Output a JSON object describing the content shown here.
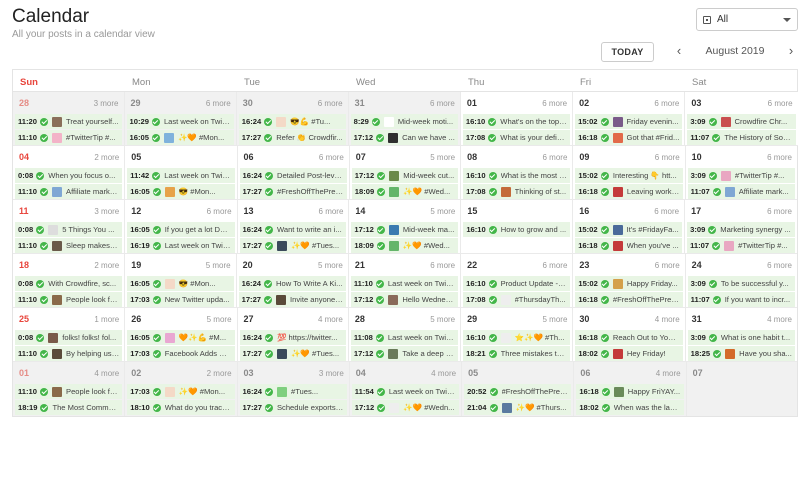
{
  "header": {
    "title": "Calendar",
    "subtitle": "All your posts in a calendar view",
    "filter_label": "All",
    "filter_icon": "facebook-page-icon"
  },
  "toolbar": {
    "today_label": "TODAY",
    "prev_glyph": "‹",
    "next_glyph": "›",
    "month_label": "August 2019"
  },
  "weekdays": [
    "Sun",
    "Mon",
    "Tue",
    "Wed",
    "Thu",
    "Fri",
    "Sat"
  ],
  "colors": {
    "accent_red": "#e8453c",
    "success_green": "#43b649",
    "post_bg": "#e8f5e4"
  },
  "weeks": [
    [
      {
        "num": "28",
        "more": "3 more",
        "other": true,
        "posts": [
          {
            "time": "11:20",
            "text": "Treat yourself...",
            "thumb": "#8a6f5a"
          },
          {
            "time": "11:10",
            "text": "#TwitterTip #...",
            "thumb": "#f3b3c8"
          }
        ]
      },
      {
        "num": "29",
        "more": "6 more",
        "other": true,
        "posts": [
          {
            "time": "10:29",
            "text": "Last week on Twitt...",
            "thumb": ""
          },
          {
            "time": "16:05",
            "text": "✨🧡 #Mon...",
            "thumb": "#7fb2dc"
          }
        ]
      },
      {
        "num": "30",
        "more": "6 more",
        "other": true,
        "posts": [
          {
            "time": "16:24",
            "text": "😎💪 #Tu...",
            "thumb": "#f4d9c7"
          },
          {
            "time": "17:27",
            "text": "Refer 👏 Crowdfir...",
            "thumb": ""
          }
        ]
      },
      {
        "num": "31",
        "more": "6 more",
        "other": true,
        "posts": [
          {
            "time": "8:29",
            "text": "Mid-week moti...",
            "thumb": "#ffffff"
          },
          {
            "time": "17:12",
            "text": "Can we have ...",
            "thumb": "#2f2f2f"
          }
        ]
      },
      {
        "num": "01",
        "more": "6 more",
        "other": false,
        "posts": [
          {
            "time": "16:10",
            "text": "What's on the top ...",
            "thumb": ""
          },
          {
            "time": "17:08",
            "text": "What is your defin...",
            "thumb": ""
          }
        ]
      },
      {
        "num": "02",
        "more": "6 more",
        "other": false,
        "posts": [
          {
            "time": "15:02",
            "text": "Friday evenin...",
            "thumb": "#7a5a8a"
          },
          {
            "time": "16:18",
            "text": "Got that #Frid...",
            "thumb": "#e26a4a"
          }
        ]
      },
      {
        "num": "03",
        "more": "6 more",
        "other": false,
        "posts": [
          {
            "time": "3:09",
            "text": "Crowdfire Chr...",
            "thumb": "#c94f4f"
          },
          {
            "time": "11:07",
            "text": "The History of Soci...",
            "thumb": ""
          }
        ]
      }
    ],
    [
      {
        "num": "04",
        "more": "2 more",
        "other": false,
        "sun": true,
        "posts": [
          {
            "time": "0:08",
            "text": "When you focus o...",
            "thumb": ""
          },
          {
            "time": "11:10",
            "text": "Affiliate marke...",
            "thumb": "#7fa7d4"
          }
        ]
      },
      {
        "num": "05",
        "more": "",
        "other": false,
        "posts": [
          {
            "time": "11:42",
            "text": "Last week on Twitt...",
            "thumb": ""
          },
          {
            "time": "16:05",
            "text": "😎 #Mon...",
            "thumb": "#e7a24a"
          }
        ]
      },
      {
        "num": "06",
        "more": "6 more",
        "other": false,
        "posts": [
          {
            "time": "16:24",
            "text": "Detailed Post-level...",
            "thumb": ""
          },
          {
            "time": "17:27",
            "text": "#FreshOffThePres...",
            "thumb": ""
          }
        ]
      },
      {
        "num": "07",
        "more": "5 more",
        "other": false,
        "posts": [
          {
            "time": "17:12",
            "text": "Mid-week cut...",
            "thumb": "#6a8a4a"
          },
          {
            "time": "18:09",
            "text": "✨🧡 #Wed...",
            "thumb": "#64b56a"
          }
        ]
      },
      {
        "num": "08",
        "more": "6 more",
        "other": false,
        "posts": [
          {
            "time": "16:10",
            "text": "What is the most c...",
            "thumb": ""
          },
          {
            "time": "17:08",
            "text": "Thinking of st...",
            "thumb": "#c46a3a"
          }
        ]
      },
      {
        "num": "09",
        "more": "6 more",
        "other": false,
        "posts": [
          {
            "time": "15:02",
            "text": "Interesting 👇 htt...",
            "thumb": ""
          },
          {
            "time": "16:18",
            "text": "Leaving work ...",
            "thumb": "#c43a3a"
          }
        ]
      },
      {
        "num": "10",
        "more": "6 more",
        "other": false,
        "posts": [
          {
            "time": "3:09",
            "text": "#TwitterTip #...",
            "thumb": "#e9a7c2"
          },
          {
            "time": "11:07",
            "text": "Affiliate mark...",
            "thumb": "#7fa7d4"
          }
        ]
      }
    ],
    [
      {
        "num": "11",
        "more": "3 more",
        "other": false,
        "sun": true,
        "posts": [
          {
            "time": "0:08",
            "text": "5 Things You ...",
            "thumb": "#dddddd"
          },
          {
            "time": "11:10",
            "text": "Sleep makes u...",
            "thumb": "#6a5a4a"
          }
        ]
      },
      {
        "num": "12",
        "more": "6 more",
        "other": false,
        "posts": [
          {
            "time": "16:05",
            "text": "If you get a lot DM...",
            "thumb": ""
          },
          {
            "time": "16:19",
            "text": "Last week on Twitt...",
            "thumb": ""
          }
        ]
      },
      {
        "num": "13",
        "more": "6 more",
        "other": false,
        "posts": [
          {
            "time": "16:24",
            "text": "Want to write an i...",
            "thumb": ""
          },
          {
            "time": "17:27",
            "text": "✨🧡 #Tues...",
            "thumb": "#3a4a5a"
          }
        ]
      },
      {
        "num": "14",
        "more": "5 more",
        "other": false,
        "posts": [
          {
            "time": "17:12",
            "text": "Mid-week ma...",
            "thumb": "#3a7ab0"
          },
          {
            "time": "18:09",
            "text": "✨🧡 #Wed...",
            "thumb": "#64b56a"
          }
        ]
      },
      {
        "num": "15",
        "more": "",
        "other": false,
        "posts": [
          {
            "time": "16:10",
            "text": "How to grow and ...",
            "thumb": ""
          }
        ]
      },
      {
        "num": "16",
        "more": "6 more",
        "other": false,
        "posts": [
          {
            "time": "15:02",
            "text": "It's #FridayFa...",
            "thumb": "#4a6a9a"
          },
          {
            "time": "16:18",
            "text": "When you've ...",
            "thumb": "#c43a3a"
          }
        ]
      },
      {
        "num": "17",
        "more": "6 more",
        "other": false,
        "posts": [
          {
            "time": "3:09",
            "text": "Marketing synergy ...",
            "thumb": ""
          },
          {
            "time": "11:07",
            "text": "#TwitterTip #...",
            "thumb": "#e9a7c2"
          }
        ]
      }
    ],
    [
      {
        "num": "18",
        "more": "2 more",
        "other": false,
        "sun": true,
        "posts": [
          {
            "time": "0:08",
            "text": "With Crowdfire, sc...",
            "thumb": ""
          },
          {
            "time": "11:10",
            "text": "People look fo...",
            "thumb": "#8a6a4a"
          }
        ]
      },
      {
        "num": "19",
        "more": "5 more",
        "other": false,
        "posts": [
          {
            "time": "16:05",
            "text": "😎 #Mon...",
            "thumb": "#f4d9c7"
          },
          {
            "time": "17:03",
            "text": "New Twitter upda...",
            "thumb": ""
          }
        ]
      },
      {
        "num": "20",
        "more": "5 more",
        "other": false,
        "posts": [
          {
            "time": "16:24",
            "text": "How To Write A Ki...",
            "thumb": ""
          },
          {
            "time": "17:27",
            "text": "Invite anyone ...",
            "thumb": "#5a4a3a"
          }
        ]
      },
      {
        "num": "21",
        "more": "6 more",
        "other": false,
        "posts": [
          {
            "time": "11:10",
            "text": "Last week on Twitt...",
            "thumb": ""
          },
          {
            "time": "17:12",
            "text": "Hello Wednes...",
            "thumb": "#8a6a5a"
          }
        ]
      },
      {
        "num": "22",
        "more": "6 more",
        "other": false,
        "posts": [
          {
            "time": "16:10",
            "text": "Product Update - I...",
            "thumb": ""
          },
          {
            "time": "17:08",
            "text": "#ThursdayTh...",
            "thumb": "#eeeeee"
          }
        ]
      },
      {
        "num": "23",
        "more": "6 more",
        "other": false,
        "posts": [
          {
            "time": "15:02",
            "text": "Happy Friday...",
            "thumb": "#d4a04a"
          },
          {
            "time": "16:18",
            "text": "#FreshOffThePres...",
            "thumb": ""
          }
        ]
      },
      {
        "num": "24",
        "more": "6 more",
        "other": false,
        "posts": [
          {
            "time": "3:09",
            "text": "To be successful y...",
            "thumb": ""
          },
          {
            "time": "11:07",
            "text": "If you want to incr...",
            "thumb": ""
          }
        ]
      }
    ],
    [
      {
        "num": "25",
        "more": "1 more",
        "other": false,
        "sun": true,
        "posts": [
          {
            "time": "0:08",
            "text": "folks! folks! fol...",
            "thumb": "#7a5a4a"
          },
          {
            "time": "11:10",
            "text": "By helping us ...",
            "thumb": "#5a4a3a"
          }
        ]
      },
      {
        "num": "26",
        "more": "5 more",
        "other": false,
        "posts": [
          {
            "time": "16:05",
            "text": "🧡✨💪 #M...",
            "thumb": "#e9a7d2"
          },
          {
            "time": "17:03",
            "text": "Facebook Adds M...",
            "thumb": ""
          }
        ]
      },
      {
        "num": "27",
        "more": "4 more",
        "other": false,
        "posts": [
          {
            "time": "16:24",
            "text": "💯 https://twitter...",
            "thumb": ""
          },
          {
            "time": "17:27",
            "text": "✨🧡 #Tues...",
            "thumb": "#3a4a5a"
          }
        ]
      },
      {
        "num": "28",
        "more": "5 more",
        "other": false,
        "posts": [
          {
            "time": "11:08",
            "text": "Last week on Twitt...",
            "thumb": ""
          },
          {
            "time": "17:12",
            "text": "Take a deep b...",
            "thumb": "#6a7a5a"
          }
        ]
      },
      {
        "num": "29",
        "more": "5 more",
        "other": false,
        "posts": [
          {
            "time": "16:10",
            "text": "⭐✨🧡 #Th...",
            "thumb": "#eeeeee"
          },
          {
            "time": "18:21",
            "text": "Three mistakes to ...",
            "thumb": ""
          }
        ]
      },
      {
        "num": "30",
        "more": "4 more",
        "other": false,
        "posts": [
          {
            "time": "16:18",
            "text": "Reach Out to Your ...",
            "thumb": ""
          },
          {
            "time": "18:02",
            "text": "Hey Friday!",
            "thumb": "#c43a3a"
          }
        ]
      },
      {
        "num": "31",
        "more": "4 more",
        "other": false,
        "posts": [
          {
            "time": "3:09",
            "text": "What is one habit t...",
            "thumb": ""
          },
          {
            "time": "18:25",
            "text": "Have you sha...",
            "thumb": "#d46a2a"
          }
        ]
      }
    ],
    [
      {
        "num": "01",
        "more": "4 more",
        "other": true,
        "sun": true,
        "posts": [
          {
            "time": "11:10",
            "text": "People look fo...",
            "thumb": "#8a6a4a"
          },
          {
            "time": "18:19",
            "text": "The Most Common...",
            "thumb": ""
          }
        ]
      },
      {
        "num": "02",
        "more": "2 more",
        "other": true,
        "posts": [
          {
            "time": "17:03",
            "text": "✨🧡 #Mon...",
            "thumb": "#f4d9c7"
          },
          {
            "time": "18:10",
            "text": "What do you track...",
            "thumb": ""
          }
        ]
      },
      {
        "num": "03",
        "more": "3 more",
        "other": true,
        "posts": [
          {
            "time": "16:24",
            "text": "#Tues...",
            "thumb": "#7fcf7f"
          },
          {
            "time": "17:27",
            "text": "Schedule exports ...",
            "thumb": ""
          }
        ]
      },
      {
        "num": "04",
        "more": "4 more",
        "other": true,
        "posts": [
          {
            "time": "11:54",
            "text": "Last week on Twitt...",
            "thumb": ""
          },
          {
            "time": "17:12",
            "text": "✨🧡 #Wedn...",
            "thumb": "#eeeeee"
          }
        ]
      },
      {
        "num": "05",
        "more": "",
        "other": true,
        "posts": [
          {
            "time": "20:52",
            "text": "#FreshOffThePres...",
            "thumb": ""
          },
          {
            "time": "21:04",
            "text": "✨🧡 #Thurs...",
            "thumb": "#5a7aa0"
          }
        ]
      },
      {
        "num": "06",
        "more": "4 more",
        "other": true,
        "posts": [
          {
            "time": "16:18",
            "text": "Happy FriYAY...",
            "thumb": "#6a8a5a"
          },
          {
            "time": "18:02",
            "text": "When was the last...",
            "thumb": ""
          }
        ]
      },
      {
        "num": "07",
        "more": "",
        "other": true,
        "posts": []
      }
    ]
  ]
}
